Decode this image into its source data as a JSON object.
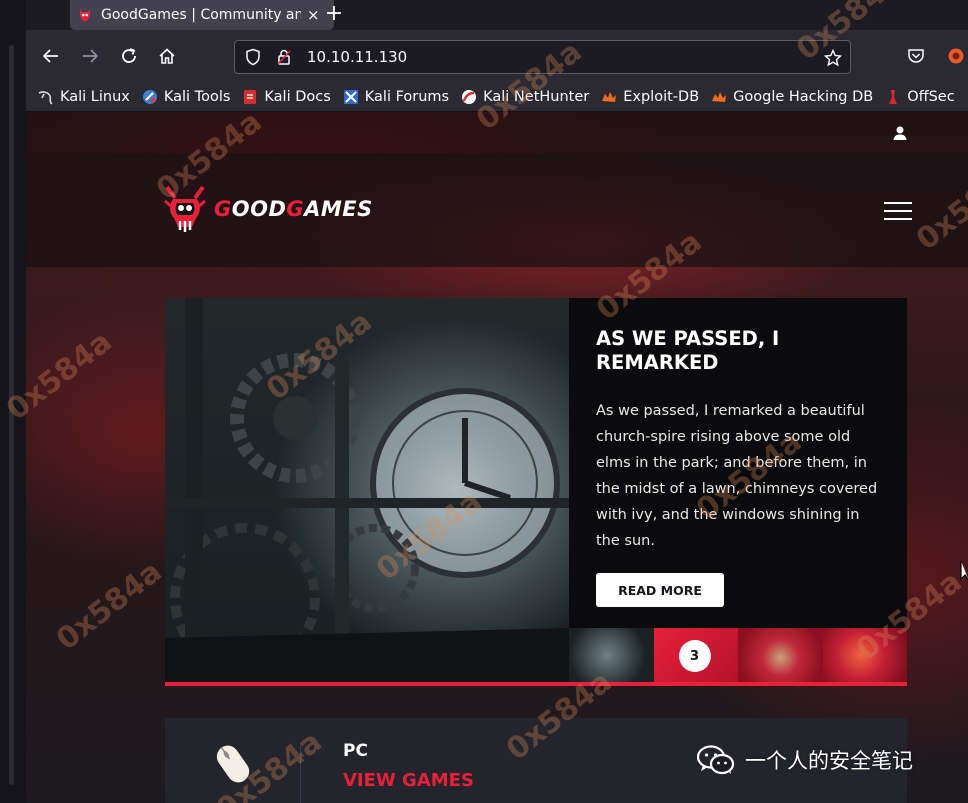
{
  "browser": {
    "tab_title": "GoodGames | Community and Store",
    "tab_close": "×",
    "new_tab": "+",
    "url": "10.10.11.130"
  },
  "bookmarks": [
    {
      "label": "Kali Linux",
      "icon": "kali-dragon-icon"
    },
    {
      "label": "Kali Tools",
      "icon": "kali-tools-icon"
    },
    {
      "label": "Kali Docs",
      "icon": "kali-docs-icon"
    },
    {
      "label": "Kali Forums",
      "icon": "kali-forums-icon"
    },
    {
      "label": "Kali NetHunter",
      "icon": "nethunter-icon"
    },
    {
      "label": "Exploit-DB",
      "icon": "exploit-db-icon"
    },
    {
      "label": "Google Hacking DB",
      "icon": "ghdb-icon"
    },
    {
      "label": "OffSec",
      "icon": "offsec-icon"
    }
  ],
  "site": {
    "logo_part1": "GOOD",
    "logo_part2": "GAMES",
    "accent_color": "#e8203a"
  },
  "slider": {
    "title": "AS WE PASSED, I REMARKED",
    "text": "As we passed, I remarked a beautiful church-spire rising above some old elms in the park; and before them, in the midst of a lawn, chimneys covered with ivy, and the windows shining in the sun.",
    "button": "READ MORE",
    "active_thumb_number": "3"
  },
  "card": {
    "title": "PC",
    "link": "VIEW GAMES"
  },
  "watermark": "0x584a",
  "brand": {
    "text": "一个人的安全笔记"
  }
}
